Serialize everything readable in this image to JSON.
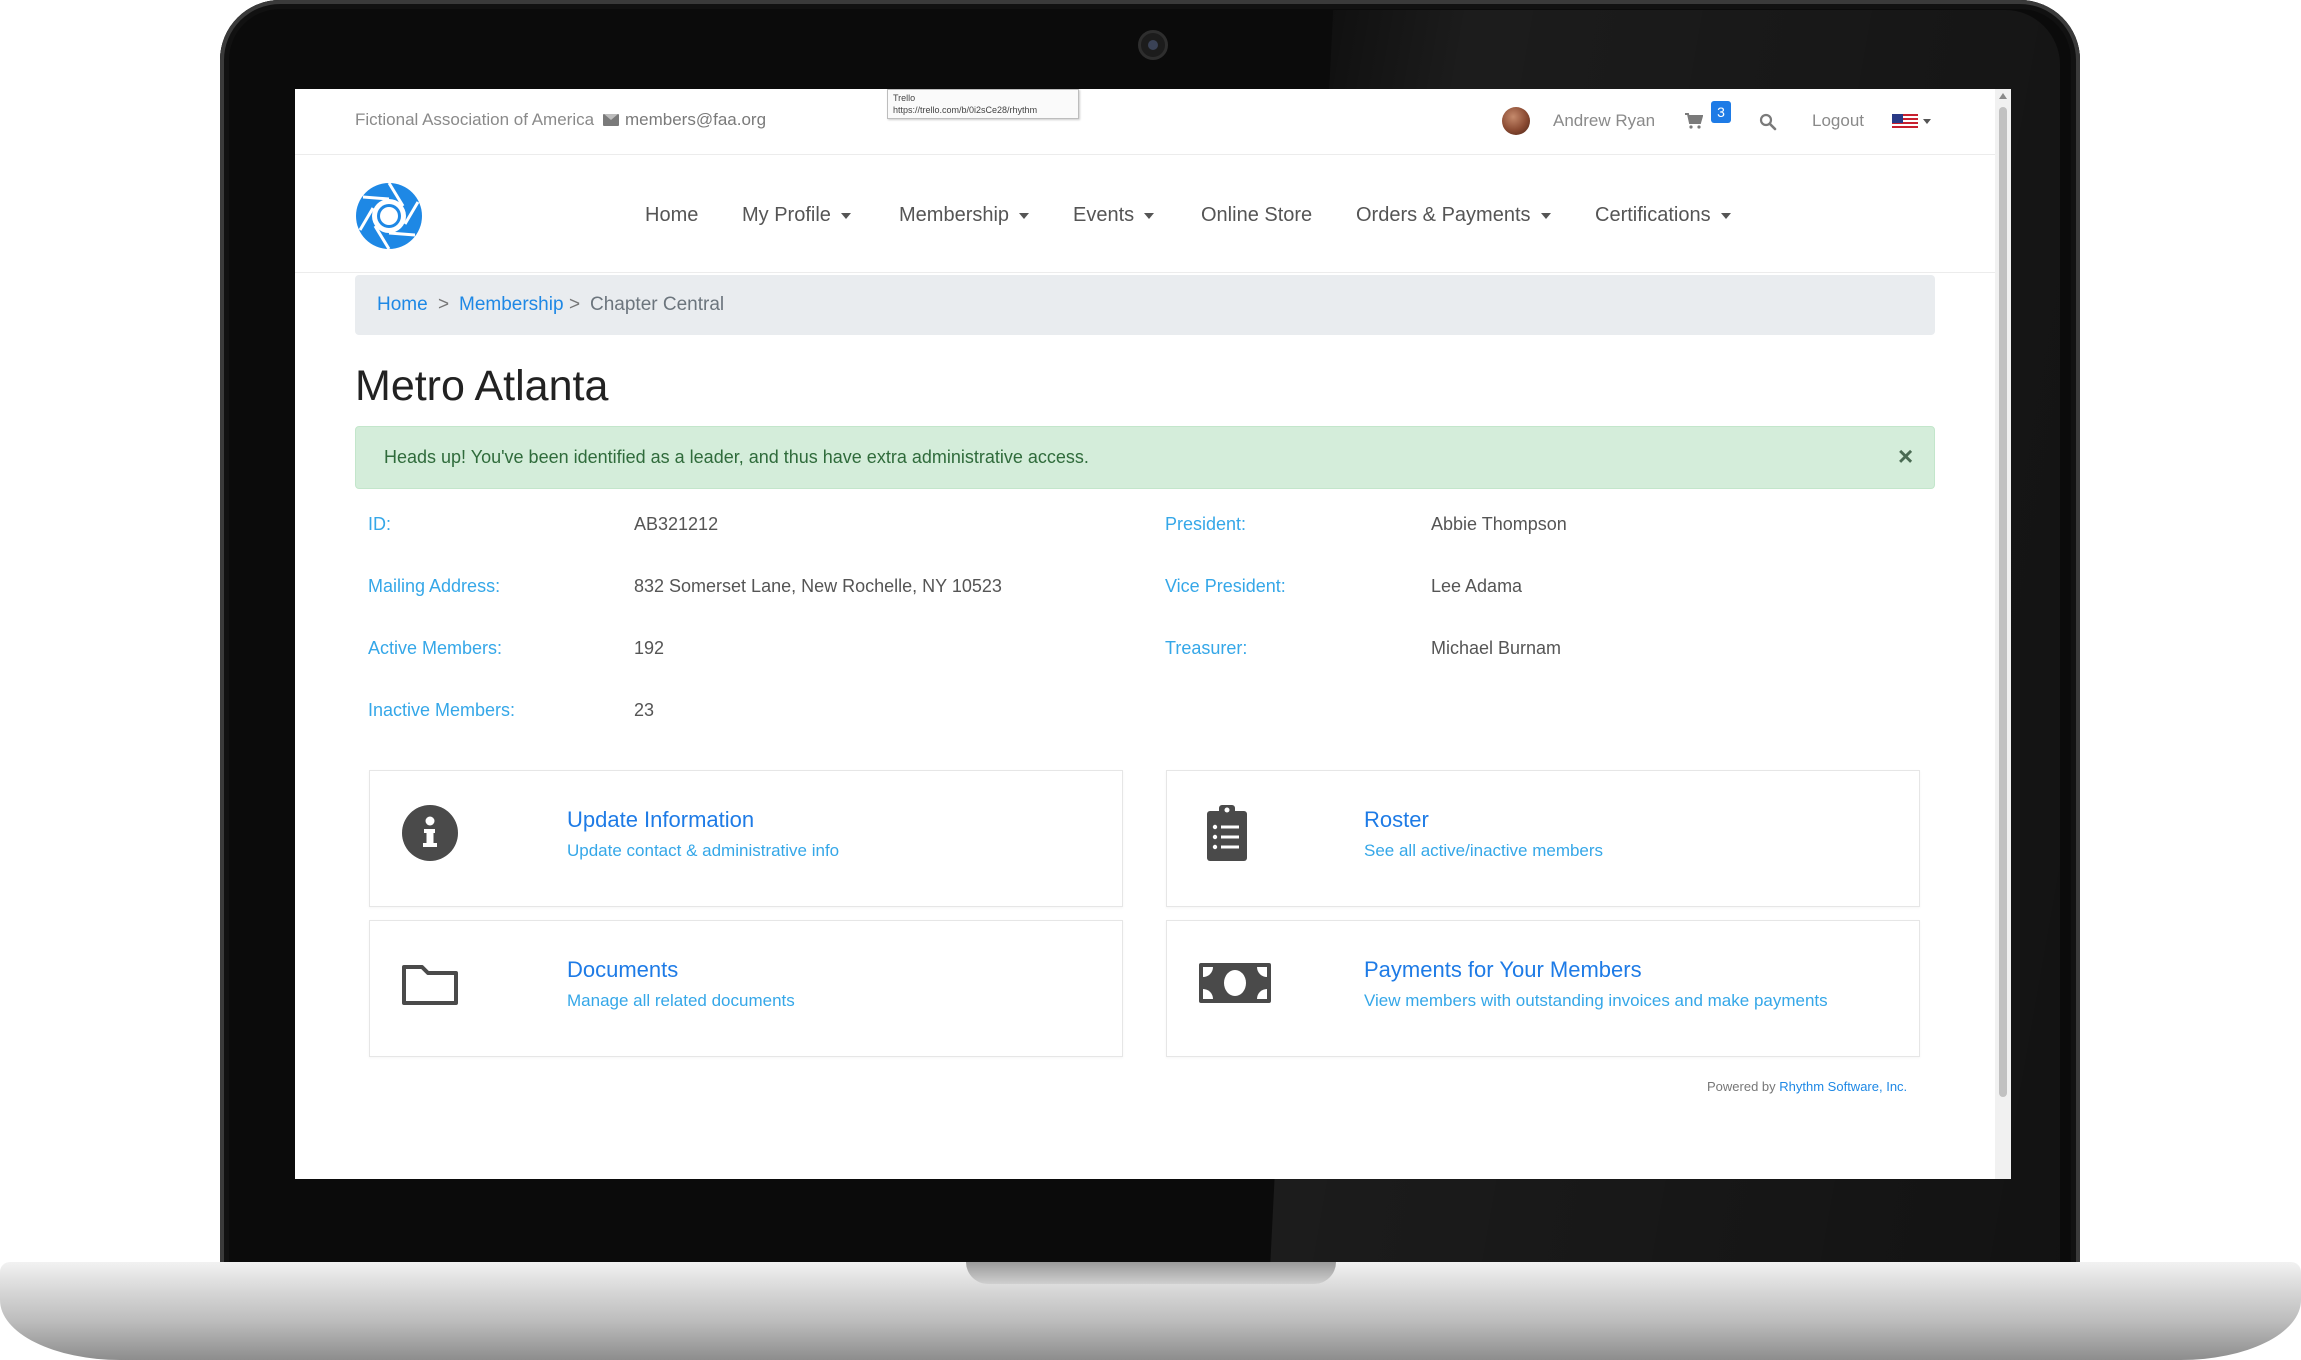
{
  "topbar": {
    "org_name": "Fictional Association of America",
    "email": "members@faa.org",
    "tooltip_title": "Trello",
    "tooltip_url": "https://trello.com/b/0i2sCe28/rhythm",
    "user_name": "Andrew Ryan",
    "cart_count": "3",
    "logout_label": "Logout"
  },
  "nav": {
    "home": "Home",
    "my_profile": "My Profile",
    "membership": "Membership",
    "events": "Events",
    "online_store": "Online Store",
    "orders_payments": "Orders & Payments",
    "certifications": "Certifications"
  },
  "breadcrumb": {
    "home": "Home",
    "membership": "Membership",
    "current": "Chapter Central",
    "separator": ">"
  },
  "page": {
    "title": "Metro Atlanta",
    "alert": "Heads up! You've been identified as a leader, and thus have extra administrative access.",
    "alert_close": "×"
  },
  "details": {
    "id_label": "ID:",
    "id_value": "AB321212",
    "address_label": "Mailing Address:",
    "address_value": "832 Somerset Lane, New Rochelle, NY 10523",
    "active_label": "Active Members:",
    "active_value": "192",
    "inactive_label": "Inactive Members:",
    "inactive_value": "23",
    "president_label": "President:",
    "president_value": "Abbie Thompson",
    "vp_label": "Vice President:",
    "vp_value": "Lee Adama",
    "treasurer_label": "Treasurer:",
    "treasurer_value": "Michael Burnam"
  },
  "cards": [
    {
      "title": "Update Information",
      "subtitle": "Update contact & administrative info",
      "icon": "info-circle-icon"
    },
    {
      "title": "Roster",
      "subtitle": "See all active/inactive members",
      "icon": "clipboard-list-icon"
    },
    {
      "title": "Documents",
      "subtitle": "Manage all related documents",
      "icon": "folder-icon"
    },
    {
      "title": "Payments for Your Members",
      "subtitle": "View members with outstanding invoices and make payments",
      "icon": "money-bill-icon"
    }
  ],
  "footer": {
    "powered_prefix": "Powered by",
    "powered_link": "Rhythm Software, Inc."
  },
  "colors": {
    "link_blue": "#1e7be6",
    "label_blue": "#35a7e8",
    "alert_bg": "#d4edda",
    "breadcrumb_bg": "#e9ecef",
    "icon_gray": "#4a4a4a"
  }
}
